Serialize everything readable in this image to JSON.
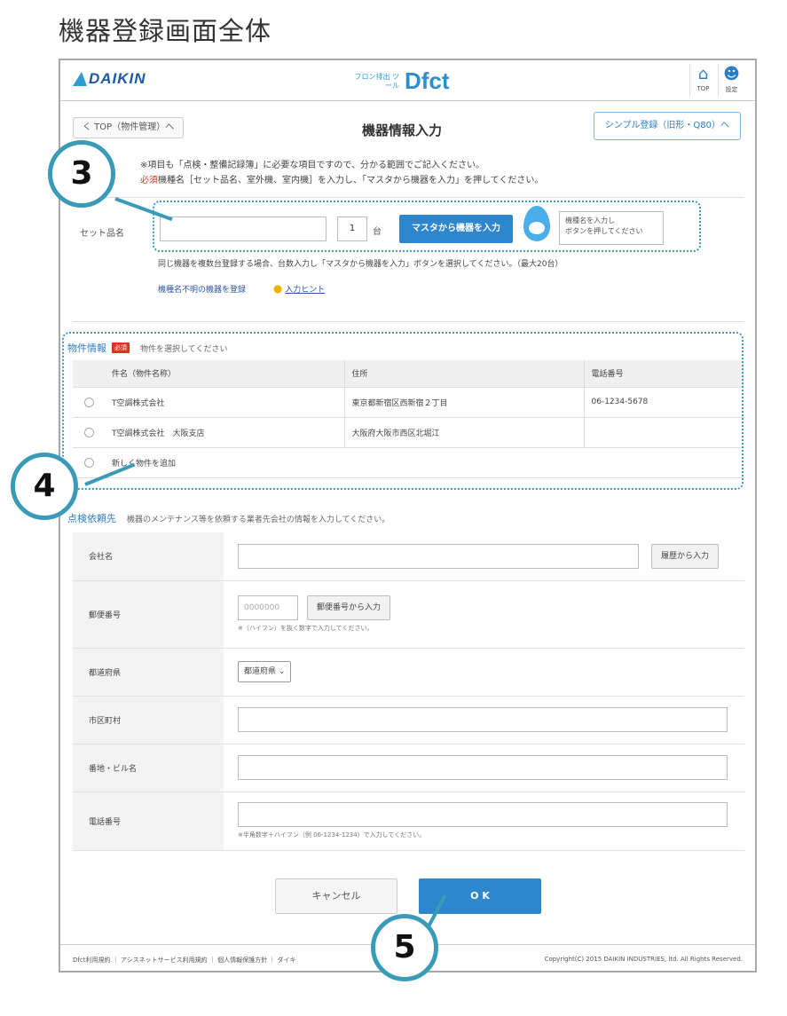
{
  "page_title": "機器登録画面全体",
  "header": {
    "logo_text": "DAIKIN",
    "tool_subtitle": "フロン排出 ツール",
    "tool_name": "Dfct",
    "top_label": "TOP",
    "settings_label": "設定"
  },
  "nav": {
    "back_label": "く TOP（物件管理）へ",
    "title": "機器情報入力",
    "simple_label": "シンプル登録（旧形・Q80）へ"
  },
  "notes": {
    "line1": "※項目も「点検・整備記録簿」に必要な項目ですので、分かる範囲でご記入ください。",
    "line2_req": "必須",
    "line2": "機種名［セット品名、室外機、室内機］を入力し、「マスタから機器を入力」を押してください。"
  },
  "set_row": {
    "label": "セット品名",
    "input_value": "",
    "qty": "1",
    "unit": "台",
    "master_button": "マスタから機器を入力",
    "hint_line1": "機種名を入力し",
    "hint_line2": "ボタンを押してください",
    "note": "同じ機器を複数台登録する場合、台数入力し「マスタから機器を入力」ボタンを選択してください。（最大20台）",
    "link_unknown": "機種名不明の機器を登録",
    "link_hint": "入力ヒント"
  },
  "property": {
    "heading": "物件情報",
    "badge": "必須",
    "subtitle": "物件を選択してください",
    "columns": [
      "件名（物件名称）",
      "住所",
      "電話番号"
    ],
    "rows": [
      {
        "name": "T空調株式会社",
        "address": "東京都新宿区西新宿２丁目",
        "phone": "06-1234-5678"
      },
      {
        "name": "T空調株式会社　大阪支店",
        "address": "大阪府大阪市西区北堀江",
        "phone": ""
      }
    ],
    "new_label": "新しく物件を追加"
  },
  "contact": {
    "heading": "点検依頼先",
    "subtitle": "機器のメンテナンス等を依頼する業者先会社の情報を入力してください。",
    "company_label": "会社名",
    "history_button": "履歴から入力",
    "postal_label": "郵便番号",
    "postal_placeholder": "0000000",
    "postal_button": "郵便番号から入力",
    "postal_help": "※（ハイフン）を抜く数字で入力してください。",
    "pref_label": "都道府県",
    "pref_value": "都道府県",
    "city_label": "市区町村",
    "addr_label": "番地・ビル名",
    "phone_label": "電話番号",
    "phone_help": "※半角数字＋ハイフン（例 06-1234-1234）で入力してください。"
  },
  "actions": {
    "cancel": "キャンセル",
    "ok": "O K"
  },
  "footer": {
    "left": "Dfct利用規約 ｜ アシスネットサービス利用規約 ｜ 個人情報保護方針 ｜ ダイキ",
    "right": "Copyright(C) 2015 DAIKIN INDUSTRIES, ltd. All Rights Reserved."
  },
  "callouts": [
    "3",
    "4",
    "5"
  ]
}
